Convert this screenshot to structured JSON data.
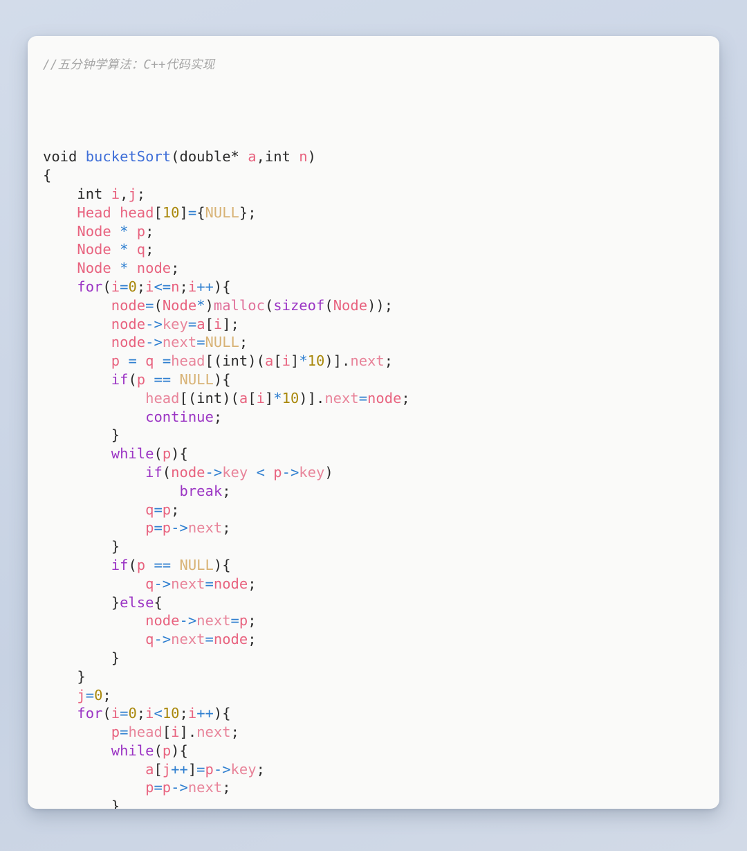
{
  "page": {
    "background_color": "#ccd6e6",
    "card_background": "#fafaf9"
  },
  "card": {
    "comment": "//五分钟学算法：C++代码实现",
    "language": "C++",
    "title": "bucketSort"
  },
  "palette": {
    "keyword": "#9b35c4",
    "function_name": "#3f6fd8",
    "identifier": "#e8637f",
    "number": "#a9880c",
    "null_constant": "#d8b275",
    "operator": "#2f7fd0",
    "plain": "#2b2b2b",
    "member": "#e8849a",
    "comment": "#a6a6a6"
  },
  "code": {
    "lines": [
      [
        {
          "t": "void ",
          "c": "t-plain"
        },
        {
          "t": "bucketSort",
          "c": "t-fn"
        },
        {
          "t": "(double* ",
          "c": "t-plain"
        },
        {
          "t": "a",
          "c": "t-ident"
        },
        {
          "t": ",int ",
          "c": "t-plain"
        },
        {
          "t": "n",
          "c": "t-ident"
        },
        {
          "t": ")",
          "c": "t-plain"
        }
      ],
      [
        {
          "t": "{",
          "c": "t-plain"
        }
      ],
      [
        {
          "t": "    int ",
          "c": "t-plain"
        },
        {
          "t": "i",
          "c": "t-ident"
        },
        {
          "t": ",",
          "c": "t-plain"
        },
        {
          "t": "j",
          "c": "t-ident"
        },
        {
          "t": ";",
          "c": "t-plain"
        }
      ],
      [
        {
          "t": "    ",
          "c": "t-plain"
        },
        {
          "t": "Head head",
          "c": "t-type"
        },
        {
          "t": "[",
          "c": "t-plain"
        },
        {
          "t": "10",
          "c": "t-num"
        },
        {
          "t": "]",
          "c": "t-plain"
        },
        {
          "t": "=",
          "c": "t-op"
        },
        {
          "t": "{",
          "c": "t-plain"
        },
        {
          "t": "NULL",
          "c": "t-null"
        },
        {
          "t": "};",
          "c": "t-plain"
        }
      ],
      [
        {
          "t": "    ",
          "c": "t-plain"
        },
        {
          "t": "Node",
          "c": "t-type"
        },
        {
          "t": " ",
          "c": "t-plain"
        },
        {
          "t": "*",
          "c": "t-op"
        },
        {
          "t": " ",
          "c": "t-plain"
        },
        {
          "t": "p",
          "c": "t-ident"
        },
        {
          "t": ";",
          "c": "t-plain"
        }
      ],
      [
        {
          "t": "    ",
          "c": "t-plain"
        },
        {
          "t": "Node",
          "c": "t-type"
        },
        {
          "t": " ",
          "c": "t-plain"
        },
        {
          "t": "*",
          "c": "t-op"
        },
        {
          "t": " ",
          "c": "t-plain"
        },
        {
          "t": "q",
          "c": "t-ident"
        },
        {
          "t": ";",
          "c": "t-plain"
        }
      ],
      [
        {
          "t": "    ",
          "c": "t-plain"
        },
        {
          "t": "Node",
          "c": "t-type"
        },
        {
          "t": " ",
          "c": "t-plain"
        },
        {
          "t": "*",
          "c": "t-op"
        },
        {
          "t": " ",
          "c": "t-plain"
        },
        {
          "t": "node",
          "c": "t-ident"
        },
        {
          "t": ";",
          "c": "t-plain"
        }
      ],
      [
        {
          "t": "    ",
          "c": "t-plain"
        },
        {
          "t": "for",
          "c": "t-kw"
        },
        {
          "t": "(",
          "c": "t-plain"
        },
        {
          "t": "i",
          "c": "t-ident"
        },
        {
          "t": "=",
          "c": "t-op"
        },
        {
          "t": "0",
          "c": "t-num"
        },
        {
          "t": ";",
          "c": "t-plain"
        },
        {
          "t": "i",
          "c": "t-ident"
        },
        {
          "t": "<=",
          "c": "t-op"
        },
        {
          "t": "n",
          "c": "t-ident"
        },
        {
          "t": ";",
          "c": "t-plain"
        },
        {
          "t": "i",
          "c": "t-ident"
        },
        {
          "t": "++",
          "c": "t-op"
        },
        {
          "t": "){",
          "c": "t-plain"
        }
      ],
      [
        {
          "t": "        ",
          "c": "t-plain"
        },
        {
          "t": "node",
          "c": "t-ident"
        },
        {
          "t": "=",
          "c": "t-op"
        },
        {
          "t": "(",
          "c": "t-plain"
        },
        {
          "t": "Node",
          "c": "t-type"
        },
        {
          "t": "*",
          "c": "t-op"
        },
        {
          "t": ")",
          "c": "t-plain"
        },
        {
          "t": "malloc",
          "c": "t-call"
        },
        {
          "t": "(",
          "c": "t-plain"
        },
        {
          "t": "sizeof",
          "c": "t-kw"
        },
        {
          "t": "(",
          "c": "t-plain"
        },
        {
          "t": "Node",
          "c": "t-type"
        },
        {
          "t": "));",
          "c": "t-plain"
        }
      ],
      [
        {
          "t": "        ",
          "c": "t-plain"
        },
        {
          "t": "node",
          "c": "t-ident"
        },
        {
          "t": "->",
          "c": "t-op"
        },
        {
          "t": "key",
          "c": "t-member"
        },
        {
          "t": "=",
          "c": "t-op"
        },
        {
          "t": "a",
          "c": "t-ident"
        },
        {
          "t": "[",
          "c": "t-plain"
        },
        {
          "t": "i",
          "c": "t-ident"
        },
        {
          "t": "];",
          "c": "t-plain"
        }
      ],
      [
        {
          "t": "        ",
          "c": "t-plain"
        },
        {
          "t": "node",
          "c": "t-ident"
        },
        {
          "t": "->",
          "c": "t-op"
        },
        {
          "t": "next",
          "c": "t-member"
        },
        {
          "t": "=",
          "c": "t-op"
        },
        {
          "t": "NULL",
          "c": "t-null"
        },
        {
          "t": ";",
          "c": "t-plain"
        }
      ],
      [
        {
          "t": "        ",
          "c": "t-plain"
        },
        {
          "t": "p",
          "c": "t-ident"
        },
        {
          "t": " ",
          "c": "t-plain"
        },
        {
          "t": "=",
          "c": "t-op"
        },
        {
          "t": " ",
          "c": "t-plain"
        },
        {
          "t": "q",
          "c": "t-ident"
        },
        {
          "t": " ",
          "c": "t-plain"
        },
        {
          "t": "=",
          "c": "t-op"
        },
        {
          "t": "head",
          "c": "t-member"
        },
        {
          "t": "[(int)(",
          "c": "t-plain"
        },
        {
          "t": "a",
          "c": "t-ident"
        },
        {
          "t": "[",
          "c": "t-plain"
        },
        {
          "t": "i",
          "c": "t-ident"
        },
        {
          "t": "]",
          "c": "t-plain"
        },
        {
          "t": "*",
          "c": "t-op"
        },
        {
          "t": "10",
          "c": "t-num"
        },
        {
          "t": ")].",
          "c": "t-plain"
        },
        {
          "t": "next",
          "c": "t-member"
        },
        {
          "t": ";",
          "c": "t-plain"
        }
      ],
      [
        {
          "t": "        ",
          "c": "t-plain"
        },
        {
          "t": "if",
          "c": "t-kw"
        },
        {
          "t": "(",
          "c": "t-plain"
        },
        {
          "t": "p",
          "c": "t-ident"
        },
        {
          "t": " ",
          "c": "t-plain"
        },
        {
          "t": "==",
          "c": "t-op"
        },
        {
          "t": " ",
          "c": "t-plain"
        },
        {
          "t": "NULL",
          "c": "t-null"
        },
        {
          "t": "){",
          "c": "t-plain"
        }
      ],
      [
        {
          "t": "            ",
          "c": "t-plain"
        },
        {
          "t": "head",
          "c": "t-member"
        },
        {
          "t": "[(int)(",
          "c": "t-plain"
        },
        {
          "t": "a",
          "c": "t-ident"
        },
        {
          "t": "[",
          "c": "t-plain"
        },
        {
          "t": "i",
          "c": "t-ident"
        },
        {
          "t": "]",
          "c": "t-plain"
        },
        {
          "t": "*",
          "c": "t-op"
        },
        {
          "t": "10",
          "c": "t-num"
        },
        {
          "t": ")].",
          "c": "t-plain"
        },
        {
          "t": "next",
          "c": "t-member"
        },
        {
          "t": "=",
          "c": "t-op"
        },
        {
          "t": "node",
          "c": "t-ident"
        },
        {
          "t": ";",
          "c": "t-plain"
        }
      ],
      [
        {
          "t": "            ",
          "c": "t-plain"
        },
        {
          "t": "continue",
          "c": "t-kw"
        },
        {
          "t": ";",
          "c": "t-plain"
        }
      ],
      [
        {
          "t": "        }",
          "c": "t-plain"
        }
      ],
      [
        {
          "t": "        ",
          "c": "t-plain"
        },
        {
          "t": "while",
          "c": "t-kw"
        },
        {
          "t": "(",
          "c": "t-plain"
        },
        {
          "t": "p",
          "c": "t-ident"
        },
        {
          "t": "){",
          "c": "t-plain"
        }
      ],
      [
        {
          "t": "            ",
          "c": "t-plain"
        },
        {
          "t": "if",
          "c": "t-kw"
        },
        {
          "t": "(",
          "c": "t-plain"
        },
        {
          "t": "node",
          "c": "t-ident"
        },
        {
          "t": "->",
          "c": "t-op"
        },
        {
          "t": "key",
          "c": "t-member"
        },
        {
          "t": " ",
          "c": "t-plain"
        },
        {
          "t": "<",
          "c": "t-op"
        },
        {
          "t": " ",
          "c": "t-plain"
        },
        {
          "t": "p",
          "c": "t-ident"
        },
        {
          "t": "->",
          "c": "t-op"
        },
        {
          "t": "key",
          "c": "t-member"
        },
        {
          "t": ")",
          "c": "t-plain"
        }
      ],
      [
        {
          "t": "                ",
          "c": "t-plain"
        },
        {
          "t": "break",
          "c": "t-kw"
        },
        {
          "t": ";",
          "c": "t-plain"
        }
      ],
      [
        {
          "t": "            ",
          "c": "t-plain"
        },
        {
          "t": "q",
          "c": "t-ident"
        },
        {
          "t": "=",
          "c": "t-op"
        },
        {
          "t": "p",
          "c": "t-ident"
        },
        {
          "t": ";",
          "c": "t-plain"
        }
      ],
      [
        {
          "t": "            ",
          "c": "t-plain"
        },
        {
          "t": "p",
          "c": "t-ident"
        },
        {
          "t": "=",
          "c": "t-op"
        },
        {
          "t": "p",
          "c": "t-ident"
        },
        {
          "t": "->",
          "c": "t-op"
        },
        {
          "t": "next",
          "c": "t-member"
        },
        {
          "t": ";",
          "c": "t-plain"
        }
      ],
      [
        {
          "t": "        }",
          "c": "t-plain"
        }
      ],
      [
        {
          "t": "        ",
          "c": "t-plain"
        },
        {
          "t": "if",
          "c": "t-kw"
        },
        {
          "t": "(",
          "c": "t-plain"
        },
        {
          "t": "p",
          "c": "t-ident"
        },
        {
          "t": " ",
          "c": "t-plain"
        },
        {
          "t": "==",
          "c": "t-op"
        },
        {
          "t": " ",
          "c": "t-plain"
        },
        {
          "t": "NULL",
          "c": "t-null"
        },
        {
          "t": "){",
          "c": "t-plain"
        }
      ],
      [
        {
          "t": "            ",
          "c": "t-plain"
        },
        {
          "t": "q",
          "c": "t-ident"
        },
        {
          "t": "->",
          "c": "t-op"
        },
        {
          "t": "next",
          "c": "t-member"
        },
        {
          "t": "=",
          "c": "t-op"
        },
        {
          "t": "node",
          "c": "t-ident"
        },
        {
          "t": ";",
          "c": "t-plain"
        }
      ],
      [
        {
          "t": "        }",
          "c": "t-plain"
        },
        {
          "t": "else",
          "c": "t-kw"
        },
        {
          "t": "{",
          "c": "t-plain"
        }
      ],
      [
        {
          "t": "            ",
          "c": "t-plain"
        },
        {
          "t": "node",
          "c": "t-ident"
        },
        {
          "t": "->",
          "c": "t-op"
        },
        {
          "t": "next",
          "c": "t-member"
        },
        {
          "t": "=",
          "c": "t-op"
        },
        {
          "t": "p",
          "c": "t-ident"
        },
        {
          "t": ";",
          "c": "t-plain"
        }
      ],
      [
        {
          "t": "            ",
          "c": "t-plain"
        },
        {
          "t": "q",
          "c": "t-ident"
        },
        {
          "t": "->",
          "c": "t-op"
        },
        {
          "t": "next",
          "c": "t-member"
        },
        {
          "t": "=",
          "c": "t-op"
        },
        {
          "t": "node",
          "c": "t-ident"
        },
        {
          "t": ";",
          "c": "t-plain"
        }
      ],
      [
        {
          "t": "        }",
          "c": "t-plain"
        }
      ],
      [
        {
          "t": "    }",
          "c": "t-plain"
        }
      ],
      [
        {
          "t": "    ",
          "c": "t-plain"
        },
        {
          "t": "j",
          "c": "t-ident"
        },
        {
          "t": "=",
          "c": "t-op"
        },
        {
          "t": "0",
          "c": "t-num"
        },
        {
          "t": ";",
          "c": "t-plain"
        }
      ],
      [
        {
          "t": "    ",
          "c": "t-plain"
        },
        {
          "t": "for",
          "c": "t-kw"
        },
        {
          "t": "(",
          "c": "t-plain"
        },
        {
          "t": "i",
          "c": "t-ident"
        },
        {
          "t": "=",
          "c": "t-op"
        },
        {
          "t": "0",
          "c": "t-num"
        },
        {
          "t": ";",
          "c": "t-plain"
        },
        {
          "t": "i",
          "c": "t-ident"
        },
        {
          "t": "<",
          "c": "t-op"
        },
        {
          "t": "10",
          "c": "t-num"
        },
        {
          "t": ";",
          "c": "t-plain"
        },
        {
          "t": "i",
          "c": "t-ident"
        },
        {
          "t": "++",
          "c": "t-op"
        },
        {
          "t": "){",
          "c": "t-plain"
        }
      ],
      [
        {
          "t": "        ",
          "c": "t-plain"
        },
        {
          "t": "p",
          "c": "t-ident"
        },
        {
          "t": "=",
          "c": "t-op"
        },
        {
          "t": "head",
          "c": "t-member"
        },
        {
          "t": "[",
          "c": "t-plain"
        },
        {
          "t": "i",
          "c": "t-ident"
        },
        {
          "t": "].",
          "c": "t-plain"
        },
        {
          "t": "next",
          "c": "t-member"
        },
        {
          "t": ";",
          "c": "t-plain"
        }
      ],
      [
        {
          "t": "        ",
          "c": "t-plain"
        },
        {
          "t": "while",
          "c": "t-kw"
        },
        {
          "t": "(",
          "c": "t-plain"
        },
        {
          "t": "p",
          "c": "t-ident"
        },
        {
          "t": "){",
          "c": "t-plain"
        }
      ],
      [
        {
          "t": "            ",
          "c": "t-plain"
        },
        {
          "t": "a",
          "c": "t-ident"
        },
        {
          "t": "[",
          "c": "t-plain"
        },
        {
          "t": "j",
          "c": "t-ident"
        },
        {
          "t": "++",
          "c": "t-op"
        },
        {
          "t": "]",
          "c": "t-plain"
        },
        {
          "t": "=",
          "c": "t-op"
        },
        {
          "t": "p",
          "c": "t-ident"
        },
        {
          "t": "->",
          "c": "t-op"
        },
        {
          "t": "key",
          "c": "t-member"
        },
        {
          "t": ";",
          "c": "t-plain"
        }
      ],
      [
        {
          "t": "            ",
          "c": "t-plain"
        },
        {
          "t": "p",
          "c": "t-ident"
        },
        {
          "t": "=",
          "c": "t-op"
        },
        {
          "t": "p",
          "c": "t-ident"
        },
        {
          "t": "->",
          "c": "t-op"
        },
        {
          "t": "next",
          "c": "t-member"
        },
        {
          "t": ";",
          "c": "t-plain"
        }
      ],
      [
        {
          "t": "        }",
          "c": "t-plain"
        }
      ],
      [
        {
          "t": "    }",
          "c": "t-plain"
        }
      ]
    ]
  }
}
